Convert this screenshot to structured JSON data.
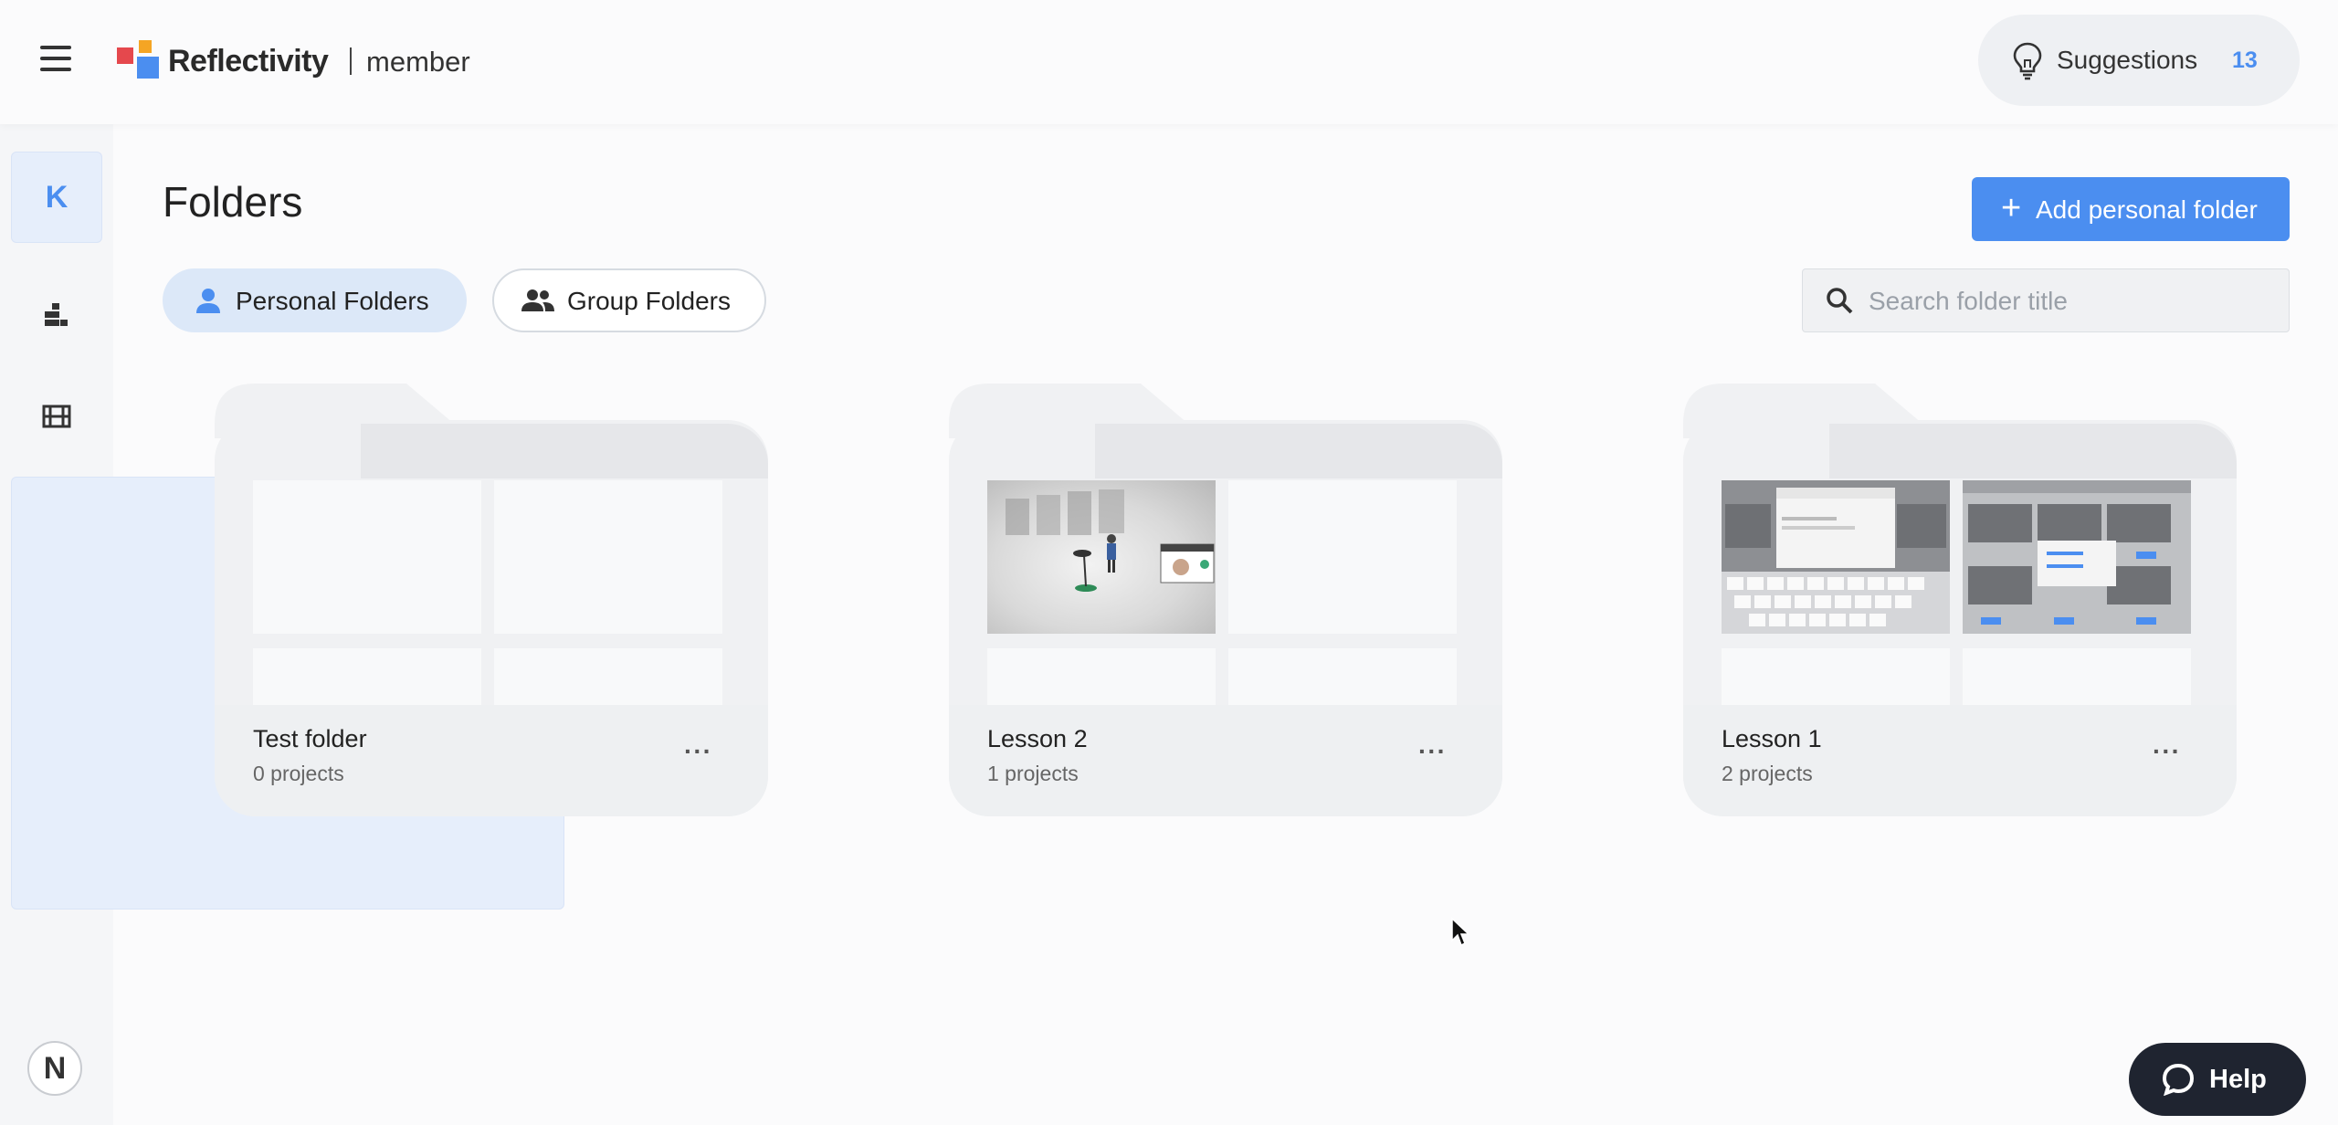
{
  "header": {
    "brand": "Reflectivity",
    "role": "member",
    "suggestions_label": "Suggestions",
    "suggestions_count": "13"
  },
  "sidebar": {
    "avatar_initial": "K",
    "items": [
      {
        "name": "account",
        "icon": "avatar-k"
      },
      {
        "name": "analytics",
        "icon": "bar-chart-icon"
      },
      {
        "name": "videos",
        "icon": "film-icon"
      },
      {
        "name": "folders",
        "icon": "folder-icon",
        "active": true
      }
    ],
    "bottom_badge": "N"
  },
  "main": {
    "title": "Folders",
    "add_button": "Add personal folder",
    "tabs": [
      {
        "label": "Personal Folders",
        "active": true
      },
      {
        "label": "Group Folders",
        "active": false
      }
    ],
    "search_placeholder": "Search folder title"
  },
  "folders": [
    {
      "name": "Test folder",
      "count": "0 projects"
    },
    {
      "name": "Lesson 2",
      "count": "1 projects"
    },
    {
      "name": "Lesson 1",
      "count": "2 projects"
    }
  ],
  "help_label": "Help",
  "colors": {
    "accent": "#4b8ef0",
    "dark": "#1f2430",
    "logo_red": "#e5484d",
    "logo_orange": "#f5a524"
  }
}
